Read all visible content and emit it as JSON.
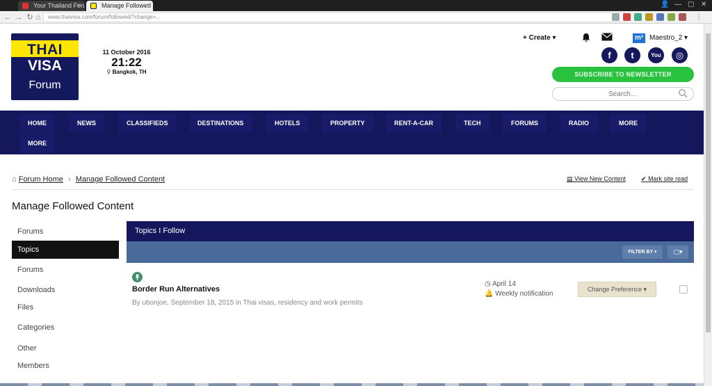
{
  "browser": {
    "tabs": [
      {
        "title": "Your Thailand Foru"
      },
      {
        "title": "Manage Followed C"
      }
    ],
    "url": "www.thaivisa.com/forum/followed/?change=..."
  },
  "header": {
    "logo": {
      "line1": "THAI",
      "line2": "VISA",
      "line3": "Forum"
    },
    "date": "11 October 2016",
    "time": "21:22",
    "location": "Bangkok, TH",
    "create_label": "Create",
    "user_badge": "m²",
    "username": "Maestro_2",
    "social": [
      {
        "icon": "facebook-icon",
        "glyph": "f"
      },
      {
        "icon": "twitter-icon",
        "glyph": "t"
      },
      {
        "icon": "youtube-icon",
        "glyph": "You"
      },
      {
        "icon": "instagram-icon",
        "glyph": "◎"
      }
    ],
    "subscribe_label": "SUBSCRIBE TO NEWSLETTER",
    "search_placeholder": "Search..."
  },
  "nav": {
    "items": [
      "HOME",
      "NEWS",
      "CLASSIFIEDS",
      "DESTINATIONS",
      "HOTELS",
      "PROPERTY",
      "RENT-A-CAR",
      "TECH",
      "FORUMS",
      "RADIO",
      "MORE",
      "MORE"
    ]
  },
  "breadcrumb": {
    "home": "Forum Home",
    "current": "Manage Followed Content",
    "view_new": "View New Content",
    "mark_read": "Mark site read"
  },
  "page": {
    "title": "Manage Followed Content"
  },
  "sidebar": {
    "items": [
      "Forums",
      "Topics",
      "Forums",
      "Downloads",
      "Files",
      "Categories",
      "Other",
      "Members"
    ],
    "active_index": 1
  },
  "content": {
    "panel_title": "Topics I Follow",
    "filter_label": "FILTER BY",
    "topic": {
      "title": "Border Run Alternatives",
      "meta": "By ubonjoe, September 18, 2015 in Thai visas, residency and work permits",
      "followed_date": "April 14",
      "notification": "Weekly notification",
      "change_pref_label": "Change Preference"
    }
  },
  "colors": {
    "brand_navy": "#14175c",
    "logo_yellow": "#ffe600",
    "subscribe_green": "#29c23e",
    "filter_blue": "#4a6a9a"
  }
}
